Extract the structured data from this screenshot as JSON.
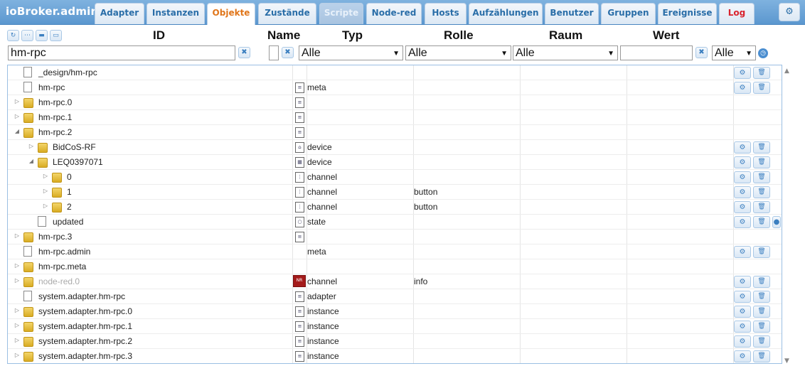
{
  "app": {
    "title": "ioBroker.admin"
  },
  "tabs": [
    {
      "label": "Adapter",
      "state": "normal"
    },
    {
      "label": "Instanzen",
      "state": "normal"
    },
    {
      "label": "Objekte",
      "state": "active"
    },
    {
      "label": "Zustände",
      "state": "normal"
    },
    {
      "label": "Scripte",
      "state": "disabled"
    },
    {
      "label": "Node-red",
      "state": "normal"
    },
    {
      "label": "Hosts",
      "state": "normal"
    },
    {
      "label": "Aufzählungen",
      "state": "normal"
    },
    {
      "label": "Benutzer",
      "state": "normal"
    },
    {
      "label": "Gruppen",
      "state": "normal"
    },
    {
      "label": "Ereignisse",
      "state": "normal"
    },
    {
      "label": "Log",
      "state": "log"
    }
  ],
  "columns": {
    "id": "ID",
    "name": "Name",
    "type": "Typ",
    "role": "Rolle",
    "room": "Raum",
    "value": "Wert"
  },
  "filters": {
    "id_value": "hm-rpc",
    "name_value": "",
    "type_selected": "Alle",
    "role_selected": "Alle",
    "room_selected": "Alle",
    "value_value": "",
    "value_type_selected": "Alle"
  },
  "icons": {
    "refresh": "refresh-icon",
    "list": "list-icon",
    "collapse": "folder-icon",
    "expand": "folder-open-icon",
    "gear": "gear-icon",
    "delete": "trash-icon",
    "clear": "close-icon",
    "clock": "clock-icon"
  },
  "colors": {
    "accent": "#5b97cf",
    "active_tab": "#e0761b",
    "log_tab": "#d9232d"
  },
  "rows": [
    {
      "indent": 0,
      "expander": "",
      "icon": "file",
      "id": "_design/hm-rpc",
      "type_icon": "",
      "type": "",
      "role": "",
      "actions": 2,
      "dim": false
    },
    {
      "indent": 0,
      "expander": "",
      "icon": "file",
      "id": "hm-rpc",
      "type_icon": "doc",
      "type": "meta",
      "role": "",
      "actions": 2,
      "dim": false
    },
    {
      "indent": 0,
      "expander": "▷",
      "icon": "folder",
      "id": "hm-rpc.0",
      "type_icon": "doc",
      "type": "",
      "role": "",
      "actions": 0,
      "dim": false
    },
    {
      "indent": 0,
      "expander": "▷",
      "icon": "folder",
      "id": "hm-rpc.1",
      "type_icon": "doc",
      "type": "",
      "role": "",
      "actions": 0,
      "dim": false
    },
    {
      "indent": 0,
      "expander": "◢",
      "icon": "folder",
      "id": "hm-rpc.2",
      "type_icon": "doc",
      "type": "",
      "role": "",
      "actions": 0,
      "dim": false
    },
    {
      "indent": 1,
      "expander": "▷",
      "icon": "folder",
      "id": "BidCoS-RF",
      "type_icon": "device",
      "type": "device",
      "role": "",
      "actions": 2,
      "dim": false
    },
    {
      "indent": 1,
      "expander": "◢",
      "icon": "folder",
      "id": "LEQ0397071",
      "type_icon": "device2",
      "type": "device",
      "role": "",
      "actions": 2,
      "dim": false
    },
    {
      "indent": 2,
      "expander": "▷",
      "icon": "folder",
      "id": "0",
      "type_icon": "channel",
      "type": "channel",
      "role": "",
      "actions": 2,
      "dim": false
    },
    {
      "indent": 2,
      "expander": "▷",
      "icon": "folder",
      "id": "1",
      "type_icon": "channel",
      "type": "channel",
      "role": "button",
      "actions": 2,
      "dim": false
    },
    {
      "indent": 2,
      "expander": "▷",
      "icon": "folder",
      "id": "2",
      "type_icon": "channel",
      "type": "channel",
      "role": "button",
      "actions": 2,
      "dim": false
    },
    {
      "indent": 1,
      "expander": "",
      "icon": "file",
      "id": "updated",
      "type_icon": "state",
      "type": "state",
      "role": "",
      "actions": 3,
      "dim": false
    },
    {
      "indent": 0,
      "expander": "▷",
      "icon": "folder",
      "id": "hm-rpc.3",
      "type_icon": "doc",
      "type": "",
      "role": "",
      "actions": 0,
      "dim": false
    },
    {
      "indent": 0,
      "expander": "",
      "icon": "file",
      "id": "hm-rpc.admin",
      "type_icon": "",
      "type": "meta",
      "role": "",
      "actions": 2,
      "dim": false
    },
    {
      "indent": 0,
      "expander": "▷",
      "icon": "folder",
      "id": "hm-rpc.meta",
      "type_icon": "",
      "type": "",
      "role": "",
      "actions": 0,
      "dim": false
    },
    {
      "indent": 0,
      "expander": "▷",
      "icon": "folder",
      "id": "node-red.0",
      "type_icon": "nodered",
      "type": "channel",
      "role": "info",
      "actions": 2,
      "dim": true
    },
    {
      "indent": 0,
      "expander": "",
      "icon": "file",
      "id": "system.adapter.hm-rpc",
      "type_icon": "doc",
      "type": "adapter",
      "role": "",
      "actions": 2,
      "dim": false
    },
    {
      "indent": 0,
      "expander": "▷",
      "icon": "folder",
      "id": "system.adapter.hm-rpc.0",
      "type_icon": "doc",
      "type": "instance",
      "role": "",
      "actions": 2,
      "dim": false
    },
    {
      "indent": 0,
      "expander": "▷",
      "icon": "folder",
      "id": "system.adapter.hm-rpc.1",
      "type_icon": "doc",
      "type": "instance",
      "role": "",
      "actions": 2,
      "dim": false
    },
    {
      "indent": 0,
      "expander": "▷",
      "icon": "folder",
      "id": "system.adapter.hm-rpc.2",
      "type_icon": "doc",
      "type": "instance",
      "role": "",
      "actions": 2,
      "dim": false
    },
    {
      "indent": 0,
      "expander": "▷",
      "icon": "folder",
      "id": "system.adapter.hm-rpc.3",
      "type_icon": "doc",
      "type": "instance",
      "role": "",
      "actions": 2,
      "dim": false
    }
  ]
}
